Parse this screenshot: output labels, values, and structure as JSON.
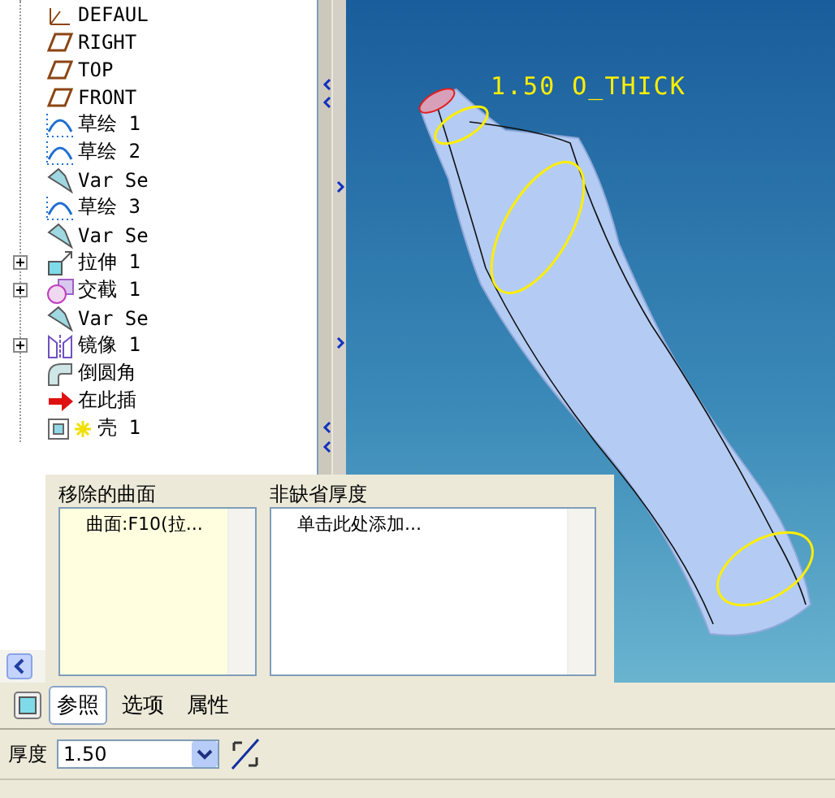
{
  "model_tree": {
    "items": [
      {
        "kind": "csys",
        "label": "DEFAUL",
        "collapsed": false
      },
      {
        "kind": "plane",
        "label": "RIGHT",
        "collapsed": false
      },
      {
        "kind": "plane",
        "label": "TOP",
        "collapsed": false
      },
      {
        "kind": "plane",
        "label": "FRONT",
        "collapsed": false
      },
      {
        "kind": "sketch",
        "label": "草绘 1",
        "collapsed": false
      },
      {
        "kind": "sketch",
        "label": "草绘 2",
        "collapsed": false
      },
      {
        "kind": "sweep",
        "label": "Var Se",
        "collapsed": false
      },
      {
        "kind": "sketch",
        "label": "草绘 3",
        "collapsed": false
      },
      {
        "kind": "sweep",
        "label": "Var Se",
        "collapsed": false
      },
      {
        "kind": "extrude",
        "label": "拉伸 1",
        "collapsed": true
      },
      {
        "kind": "intersect",
        "label": "交截 1",
        "collapsed": true
      },
      {
        "kind": "sweep",
        "label": "Var Se",
        "collapsed": false
      },
      {
        "kind": "mirror",
        "label": "镜像 1",
        "collapsed": true
      },
      {
        "kind": "round",
        "label": "倒圆角",
        "collapsed": false
      },
      {
        "kind": "insert",
        "label": "在此插",
        "collapsed": false
      },
      {
        "kind": "shell",
        "label": "壳 1",
        "collapsed": false
      }
    ]
  },
  "viewport": {
    "dimension_label": "1.50 O_THICK"
  },
  "references_panel": {
    "removed_surfaces": {
      "heading": "移除的曲面",
      "items": [
        "曲面:F10(拉..."
      ]
    },
    "non_default_thickness": {
      "heading": "非缺省厚度",
      "items": [
        "单击此处添加..."
      ]
    }
  },
  "tabs": [
    {
      "label": "参照",
      "selected": true
    },
    {
      "label": "选项",
      "selected": false
    },
    {
      "label": "属性",
      "selected": false
    }
  ],
  "thickness": {
    "label": "厚度",
    "value": "1.50"
  }
}
